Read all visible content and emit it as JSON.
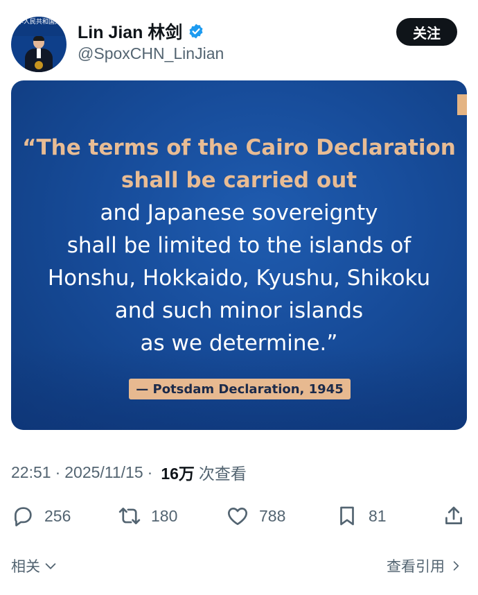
{
  "header": {
    "avatar_caption": "中华人民共和国外交部 Ministry of Foreign Affairs",
    "display_name": "Lin Jian 林剑",
    "handle": "@SpoxCHN_LinJian",
    "follow_label": "关注",
    "verified_color": "#1d9bf0"
  },
  "card": {
    "quote_lines": [
      "“The terms of the Cairo Declaration",
      "shall be carried out",
      "and Japanese sovereignty",
      "shall be limited to the islands of",
      "Honshu, Hokkaido, Kyushu, Shikoku",
      "and such minor islands",
      "as we determine.”"
    ],
    "attribution": "— Potsdam Declaration, 1945",
    "highlight_color": "#e8bc94",
    "background_color": "#174c9a"
  },
  "meta": {
    "time": "22:51",
    "separator": "·",
    "date": "2025/11/15",
    "views_count": "16万",
    "views_label": "次查看"
  },
  "actions": {
    "replies": "256",
    "reposts": "180",
    "likes": "788",
    "bookmarks": "81"
  },
  "footer": {
    "related_label": "相关",
    "quotes_label": "查看引用"
  }
}
